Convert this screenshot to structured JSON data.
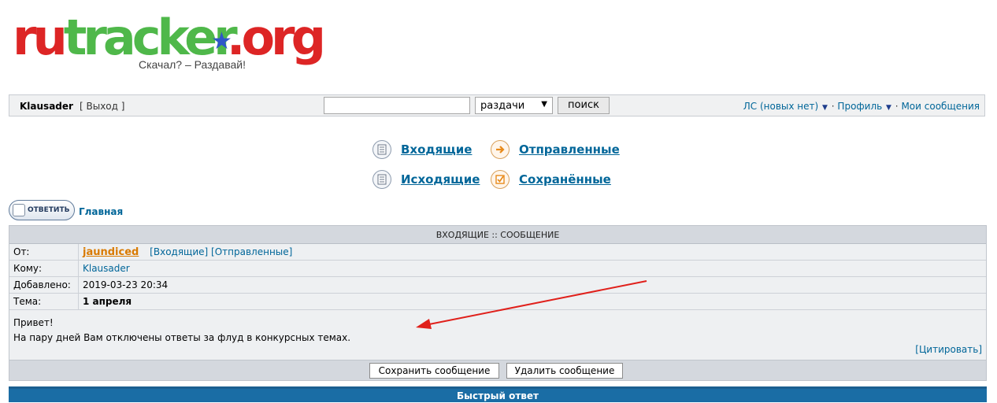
{
  "logo": {
    "part1": "ru",
    "part2": "tracker",
    "part3": ".org",
    "slogan": "Скачал? – Раздавай!"
  },
  "topbar": {
    "username": "Klausader",
    "logout": "[ Выход ]",
    "search_value": "",
    "search_scope": "раздачи",
    "search_button": "поиск",
    "pm_link": "ЛС (новых нет)",
    "sep1": "·",
    "profile_link": "Профиль",
    "sep2": "·",
    "my_messages_link": "Мои сообщения"
  },
  "folders": {
    "inbox": "Входящие",
    "sent": "Отправленные",
    "outbox": "Исходящие",
    "saved": "Сохранённые"
  },
  "actions": {
    "reply": "ОТВЕТИТЬ",
    "home": "Главная"
  },
  "message": {
    "header": "ВХОДЯЩИЕ :: СООБЩЕНИЕ",
    "from_label": "От:",
    "from_user": "jaundiced",
    "from_inbox_link": "[Входящие]",
    "from_sent_link": "[Отправленные]",
    "to_label": "Кому:",
    "to_user": "Klausader",
    "date_label": "Добавлено:",
    "date_value": "2019-03-23 20:34",
    "subject_label": "Тема:",
    "subject_value": "1 апреля",
    "body_line1": "Привет!",
    "body_line2": "На пару дней Вам отключены ответы за флуд в конкурсных темах.",
    "quote": "[Цитировать]",
    "save_button": "Сохранить сообщение",
    "delete_button": "Удалить сообщение"
  },
  "quick_reply": "Быстрый ответ",
  "colors": {
    "link": "#006699",
    "sender": "#d97a00",
    "quick_bar": "#1a6da5",
    "annotation": "#e0201b"
  }
}
